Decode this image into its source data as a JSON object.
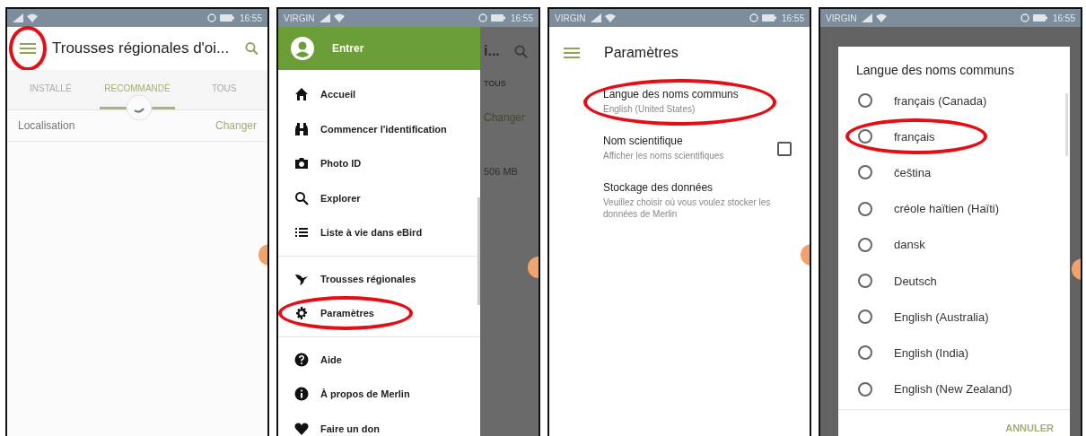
{
  "screens": [
    {
      "kind": "kits",
      "status_bar": {
        "time": "16:55"
      },
      "menu_button": {
        "highlighted": true
      },
      "title": "Trousses régionales d'oi...",
      "tabs": [
        {
          "label": "INSTALLÉ",
          "selected": false
        },
        {
          "label": "RECOMMANDÉ",
          "selected": true
        },
        {
          "label": "TOUS",
          "selected": false
        }
      ],
      "location": {
        "label": "Localisation",
        "action": "Changer"
      }
    },
    {
      "kind": "drawer",
      "status_bar": {
        "carrier": "VIRGIN",
        "time": "16:55"
      },
      "account": "Entrer",
      "groups": [
        [
          {
            "label": "Accueil",
            "highlighted": false
          },
          {
            "label": "Commencer l'identification",
            "highlighted": false
          },
          {
            "label": "Photo ID",
            "highlighted": false
          },
          {
            "label": "Explorer",
            "highlighted": false
          },
          {
            "label": "Liste à vie dans eBird",
            "highlighted": false
          }
        ],
        [
          {
            "label": "Trousses régionales",
            "highlighted": false
          },
          {
            "label": "Paramètres",
            "highlighted": true
          }
        ],
        [
          {
            "label": "Aide",
            "highlighted": false
          },
          {
            "label": "À propos de Merlin",
            "highlighted": false
          },
          {
            "label": "Faire un don",
            "highlighted": false
          }
        ]
      ],
      "behind": {
        "title": "i...",
        "tab": "TOUS",
        "action": "Changer",
        "size": "506 MB"
      }
    },
    {
      "kind": "settings",
      "status_bar": {
        "carrier": "VIRGIN",
        "time": "16:55"
      },
      "title": "Paramètres",
      "items": [
        {
          "title": "Langue des noms communs",
          "summary": "English (United States)",
          "highlighted": true
        },
        {
          "title": "Nom scientifique",
          "summary": "Afficher les noms scientifiques",
          "checked": false,
          "highlighted": false
        },
        {
          "title": "Stockage des données",
          "summary": "Veuillez choisir où vous voulez stocker les données de Merlin",
          "highlighted": false
        }
      ]
    },
    {
      "kind": "language_dialog",
      "status_bar": {
        "carrier": "VIRGIN",
        "time": "16:55"
      },
      "title": "Langue des noms communs",
      "options": [
        {
          "label": "français (Canada)",
          "selected": false,
          "highlighted": false
        },
        {
          "label": "français",
          "selected": false,
          "highlighted": true
        },
        {
          "label": "čeština",
          "selected": false,
          "highlighted": false
        },
        {
          "label": "créole haïtien (Haïti)",
          "selected": false,
          "highlighted": false
        },
        {
          "label": "dansk",
          "selected": false,
          "highlighted": false
        },
        {
          "label": "Deutsch",
          "selected": false,
          "highlighted": false
        },
        {
          "label": "English (Australia)",
          "selected": false,
          "highlighted": false
        },
        {
          "label": "English (India)",
          "selected": false,
          "highlighted": false
        },
        {
          "label": "English (New Zealand)",
          "selected": false,
          "highlighted": false
        }
      ],
      "cancel": "ANNULER"
    }
  ]
}
